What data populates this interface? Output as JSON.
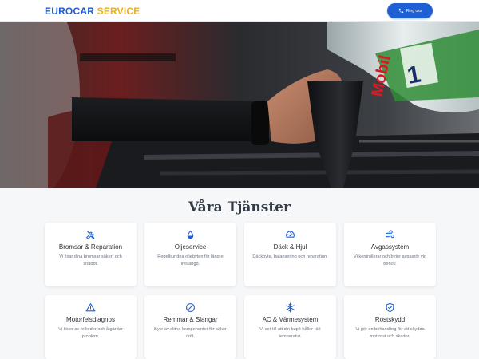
{
  "header": {
    "logo_part1": "EUROCAR",
    "logo_part2": "SERVICE",
    "call_label": "Ring oss"
  },
  "hero": {
    "image": "mechanic-pouring-mobil-engine-oil",
    "bottle_brand": "Mobil",
    "bottle_number": "1"
  },
  "services": {
    "title": "Våra Tjänster",
    "items": [
      {
        "icon": "wrench-screwdriver-icon",
        "title": "Bromsar & Reparation",
        "desc": "Vi fixar dina bromsar säkert och snabbt."
      },
      {
        "icon": "oil-drop-icon",
        "title": "Oljeservice",
        "desc": "Regelbundna oljebyten för längre livslängd."
      },
      {
        "icon": "speedometer-icon",
        "title": "Däck & Hjul",
        "desc": "Däckbyte, balansering och reparation."
      },
      {
        "icon": "wind-icon",
        "title": "Avgassystem",
        "desc": "Vi kontrollerar och byter avgasrör vid behov."
      },
      {
        "icon": "warning-triangle-icon",
        "title": "Motorfelsdiagnos",
        "desc": "Vi löser av felkoder och åtgärdar problem."
      },
      {
        "icon": "compass-icon",
        "title": "Remmar & Slangar",
        "desc": "Byte av slitna komponenter för säker drift."
      },
      {
        "icon": "snowflake-icon",
        "title": "AC & Värmesystem",
        "desc": "Vi ser till att din kupé håller rätt temperatur."
      },
      {
        "icon": "shield-check-icon",
        "title": "Rostskydd",
        "desc": "Vi gör en behandling för att skydda mot rost och skador."
      }
    ]
  },
  "colors": {
    "accent": "#1e5fd3",
    "logo_secondary": "#e8b21c"
  }
}
